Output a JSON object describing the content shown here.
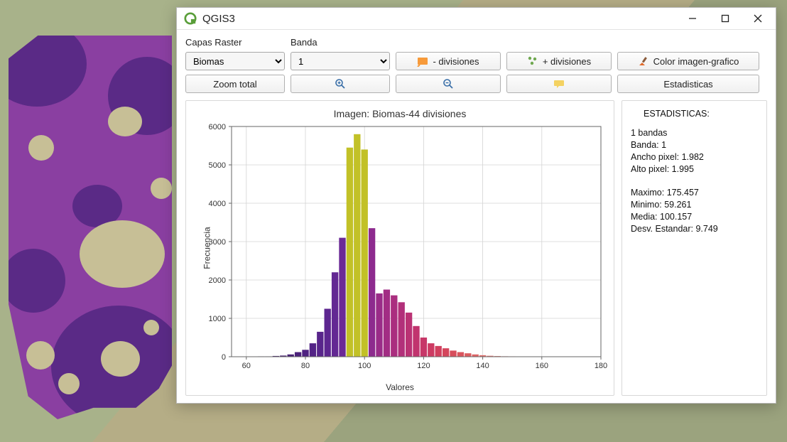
{
  "window": {
    "title": "QGIS3"
  },
  "toolbar": {
    "layers_label": "Capas Raster",
    "band_label": "Banda",
    "layer_select": {
      "value": "Biomas",
      "options": [
        "Biomas"
      ]
    },
    "band_select": {
      "value": "1",
      "options": [
        "1"
      ]
    },
    "btn_minus_div": "- divisiones",
    "btn_plus_div": "+ divisiones",
    "btn_color": "Color imagen-grafico",
    "btn_zoom_all": "Zoom total",
    "btn_stats": "Estadisticas"
  },
  "stats": {
    "header": "ESTADISTICAS:",
    "lines": [
      "1 bandas",
      "Banda: 1",
      "Ancho pixel: 1.982",
      "Alto pixel: 1.995",
      "",
      "Maximo: 175.457",
      "Minimo: 59.261",
      "Media: 100.157",
      "Desv. Estandar: 9.749"
    ]
  },
  "chart_data": {
    "type": "bar",
    "title": "Imagen: Biomas-44 divisiones",
    "xlabel": "Valores",
    "ylabel": "Frecuencia",
    "xlim": [
      55,
      180
    ],
    "ylim": [
      0,
      6000
    ],
    "yticks": [
      0,
      1000,
      2000,
      3000,
      4000,
      5000,
      6000
    ],
    "xticks": [
      60,
      80,
      100,
      120,
      140,
      160,
      180
    ],
    "categories": [
      59,
      62,
      65,
      67.5,
      70,
      72.5,
      75,
      77.5,
      80,
      82.5,
      85,
      87.5,
      90,
      92.5,
      95,
      97.5,
      100,
      102.5,
      105,
      107.5,
      110,
      112.5,
      115,
      117.5,
      120,
      122.5,
      125,
      127.5,
      130,
      132.5,
      135,
      137.5,
      140,
      142.5,
      145,
      147.5,
      150,
      152.5,
      155,
      157.5,
      160,
      165,
      170,
      175
    ],
    "values": [
      5,
      5,
      10,
      10,
      20,
      30,
      60,
      120,
      180,
      350,
      650,
      1250,
      2200,
      3100,
      5450,
      5800,
      5400,
      3350,
      1650,
      1750,
      1600,
      1420,
      1150,
      800,
      500,
      350,
      280,
      220,
      160,
      120,
      90,
      60,
      40,
      25,
      18,
      12,
      10,
      8,
      6,
      5,
      4,
      3,
      2,
      2
    ],
    "colors": [
      "#3b1d58",
      "#3b1d58",
      "#3d1e5d",
      "#3f1f63",
      "#421f68",
      "#45206e",
      "#482174",
      "#4b217a",
      "#4e2280",
      "#532386",
      "#58258b",
      "#5d2690",
      "#632893",
      "#6b2996",
      "#c2c127",
      "#c2c127",
      "#c2c127",
      "#8d2b8e",
      "#9a2c88",
      "#a22d84",
      "#aa2e7f",
      "#b2307a",
      "#ba3274",
      "#c1346e",
      "#c73768",
      "#cd3b63",
      "#d1405f",
      "#d4465c",
      "#d74d5c",
      "#d9555e",
      "#db5d61",
      "#dd6566",
      "#de6e6c",
      "#df7773",
      "#e0807a",
      "#e18982",
      "#e2928a",
      "#e39b93",
      "#e4a49c",
      "#e5ada5",
      "#e6b6ae",
      "#e7beb7",
      "#e7c5bf",
      "#e8ccc6"
    ]
  }
}
